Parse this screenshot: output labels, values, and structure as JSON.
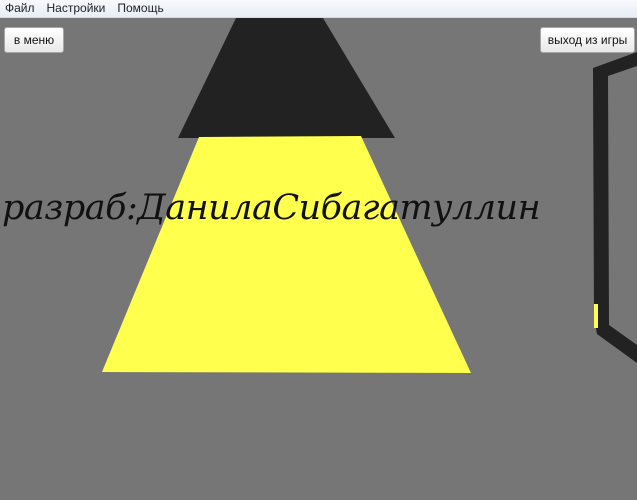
{
  "menubar": {
    "items": [
      "Файл",
      "Настройки",
      "Помощь"
    ]
  },
  "buttons": {
    "menu_label": "в меню",
    "exit_label": "выход из игры"
  },
  "credits": {
    "text": "разраб:ДанилаСибагатуллин"
  },
  "scene": {
    "background_color": "#767676",
    "lamp_shade_color": "#222222",
    "light_color": "#ffff4d",
    "door_frame_color": "#222222"
  }
}
